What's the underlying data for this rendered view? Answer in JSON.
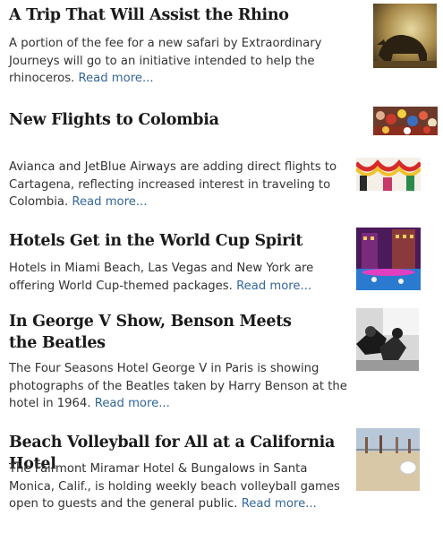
{
  "stories": [
    {
      "headline": "A Trip That Will Assist the Rhino",
      "summary": "A portion of the fee for a new safari by Extraordinary Journeys will go to an initiative intended to help the rhinoceros.",
      "read_more": "Read more..."
    },
    {
      "headline": "New Flights to Colombia",
      "summary": "Avianca and JetBlue Airways are adding direct flights to Cartagena, reflecting increased interest in traveling to Colombia.",
      "read_more": "Read more..."
    },
    {
      "headline": "Hotels Get in the World Cup Spirit",
      "summary": "Hotels in Miami Beach, Las Vegas and New York are offering World Cup-themed packages.",
      "read_more": "Read more..."
    },
    {
      "headline": "In George V Show, Benson Meets the Beatles",
      "summary": "The Four Seasons Hotel George V in Paris is showing photographs of the Beatles taken by Harry Benson at the hotel in 1964.",
      "read_more": "Read more..."
    },
    {
      "headline": "Beach Volleyball for All at a California Hotel",
      "summary": "The Fairmont Miramar Hotel & Bungalows in Santa Monica, Calif., is holding weekly beach volleyball games open to guests and the general public.",
      "read_more": "Read more..."
    }
  ],
  "thumbnails": {
    "rhino": "rhino-photo",
    "colombia_top": "colombia-crowd-photo",
    "colombia_side": "colombia-festival-photo",
    "world_cup": "hotel-pool-party-photo",
    "beatles": "beatles-photo",
    "volleyball": "beach-volleyball-photo"
  }
}
